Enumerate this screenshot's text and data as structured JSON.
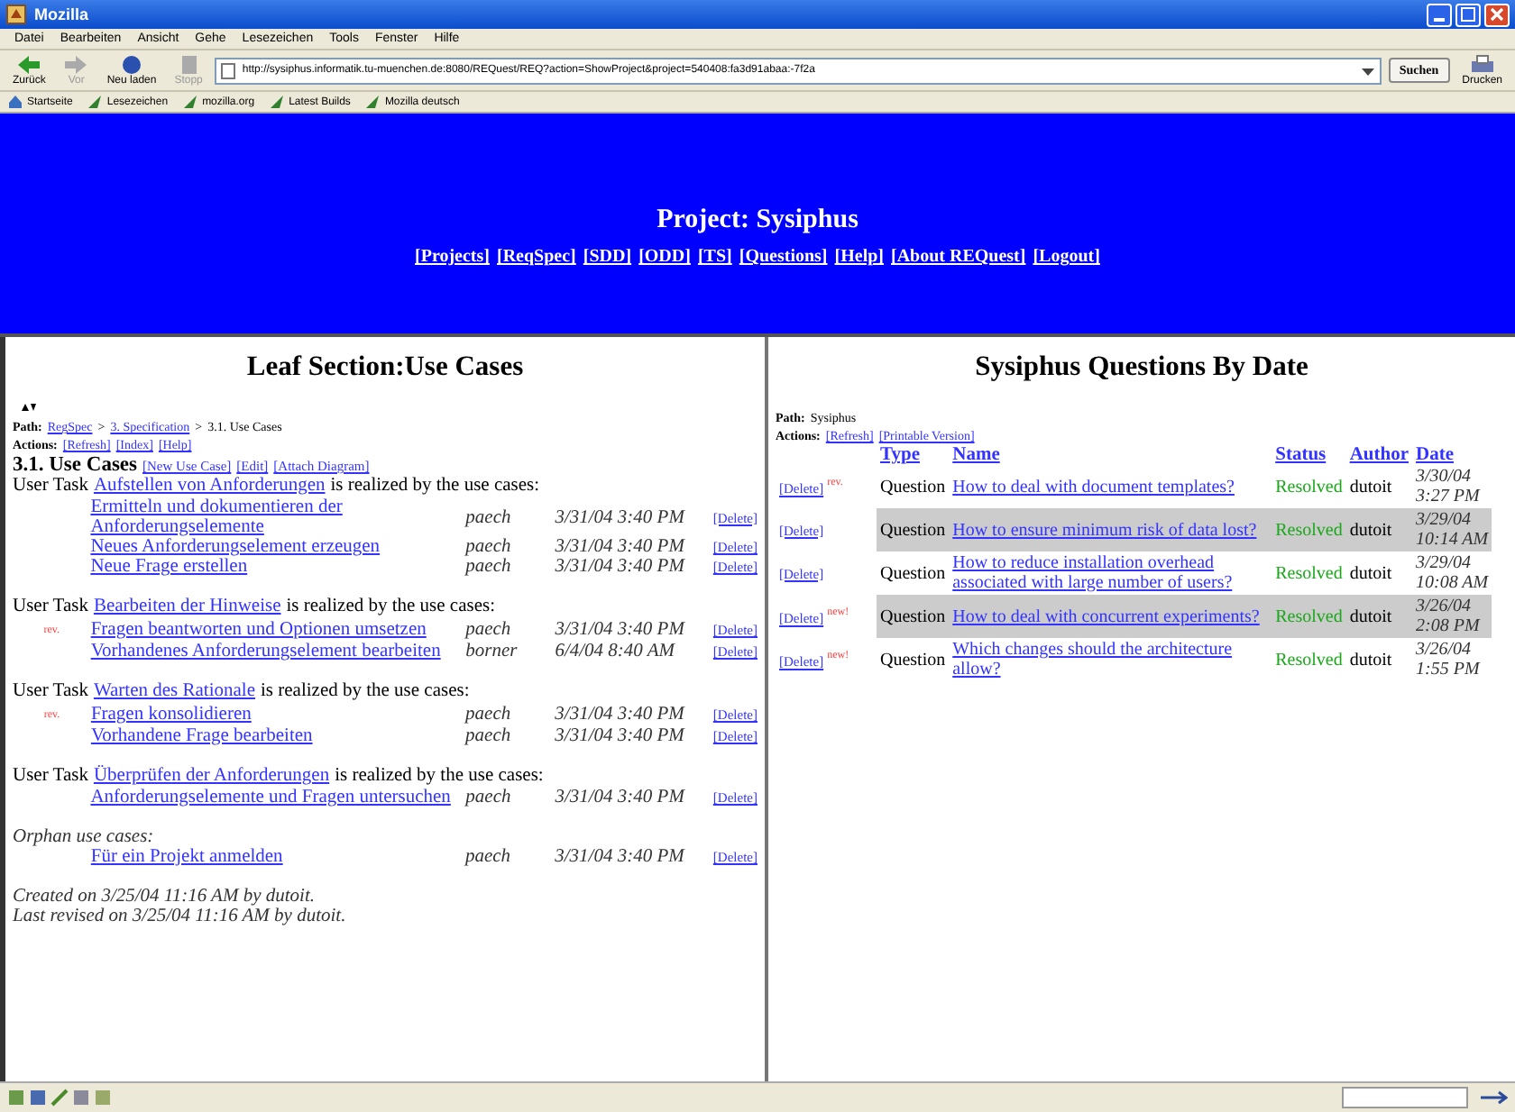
{
  "window": {
    "title": "Mozilla"
  },
  "menu": [
    "Datei",
    "Bearbeiten",
    "Ansicht",
    "Gehe",
    "Lesezeichen",
    "Tools",
    "Fenster",
    "Hilfe"
  ],
  "nav_buttons": [
    {
      "label": "Zurück",
      "disabled": false
    },
    {
      "label": "Vor",
      "disabled": true
    },
    {
      "label": "Neu laden",
      "disabled": false
    },
    {
      "label": "Stopp",
      "disabled": true
    }
  ],
  "url": "http://sysiphus.informatik.tu-muenchen.de:8080/REQuest/REQ?action=ShowProject&project=540408:fa3d91abaa:-7f2a",
  "search_button": "Suchen",
  "print_button": "Drucken",
  "bookmarks": [
    "Startseite",
    "Lesezeichen",
    "mozilla.org",
    "Latest Builds",
    "Mozilla deutsch"
  ],
  "header": {
    "title": "Project: Sysiphus",
    "links": [
      "[Projects]",
      "[ReqSpec]",
      "[SDD]",
      "[ODD]",
      "[TS]",
      "[Questions]",
      "[Help]",
      "[About REQuest]",
      "[Logout]"
    ]
  },
  "left": {
    "heading": "Leaf Section:Use Cases",
    "path_label": "Path:",
    "path": [
      {
        "text": "RegSpec",
        "link": true
      },
      {
        "text": ">",
        "link": false
      },
      {
        "text": "3. Specification",
        "link": true
      },
      {
        "text": ">",
        "link": false
      },
      {
        "text": "3.1. Use Cases",
        "link": false
      }
    ],
    "actions_label": "Actions:",
    "actions": [
      "[Refresh]",
      "[Index]",
      "[Help]"
    ],
    "section_title": "3.1. Use Cases",
    "section_actions": [
      "[New Use Case]",
      "[Edit]",
      "[Attach Diagram]"
    ],
    "tasks": [
      {
        "prefix": "User Task",
        "name": "Aufstellen von Anforderungen",
        "suffix": "is realized by the use cases:",
        "use_cases": [
          {
            "name": "Ermitteln und dokumentieren der Anforderungselemente",
            "author": "paech",
            "date": "3/31/04 3:40 PM",
            "delete": "[Delete]"
          },
          {
            "name": "Neues Anforderungselement erzeugen",
            "author": "paech",
            "date": "3/31/04 3:40 PM",
            "delete": "[Delete]"
          },
          {
            "name": "Neue Frage erstellen",
            "author": "paech",
            "date": "3/31/04 3:40 PM",
            "delete": "[Delete]"
          }
        ]
      },
      {
        "prefix": "User Task",
        "name": "Bearbeiten der Hinweise",
        "suffix": "is realized by the use cases:",
        "use_cases": [
          {
            "marker": "rev.",
            "name": "Fragen beantworten und Optionen umsetzen",
            "author": "paech",
            "date": "3/31/04 3:40 PM",
            "delete": "[Delete]"
          },
          {
            "name": "Vorhandenes Anforderungselement bearbeiten",
            "author": "borner",
            "date": "6/4/04 8:40 AM",
            "delete": "[Delete]"
          }
        ]
      },
      {
        "prefix": "User Task",
        "name": "Warten des Rationale",
        "suffix": "is realized by the use cases:",
        "use_cases": [
          {
            "marker": "rev.",
            "name": "Fragen konsolidieren",
            "author": "paech",
            "date": "3/31/04 3:40 PM",
            "delete": "[Delete]"
          },
          {
            "name": "Vorhandene Frage bearbeiten",
            "author": "paech",
            "date": "3/31/04 3:40 PM",
            "delete": "[Delete]"
          }
        ]
      },
      {
        "prefix": "User Task",
        "name": "Überprüfen der Anforderungen",
        "suffix": "is realized by the use cases:",
        "use_cases": [
          {
            "name": "Anforderungselemente und Fragen untersuchen",
            "author": "paech",
            "date": "3/31/04 3:40 PM",
            "delete": "[Delete]"
          }
        ]
      }
    ],
    "orphan": {
      "label": "Orphan use cases:",
      "use_cases": [
        {
          "name": "Für ein Projekt anmelden",
          "author": "paech",
          "date": "3/31/04 3:40 PM",
          "delete": "[Delete]"
        }
      ]
    },
    "created": "Created on 3/25/04 11:16 AM by dutoit.",
    "revised": "Last revised on 3/25/04 11:16 AM by dutoit."
  },
  "right": {
    "heading": "Sysiphus Questions By Date",
    "path_label": "Path:",
    "path": "Sysiphus",
    "actions_label": "Actions:",
    "actions": [
      "[Refresh]",
      "[Printable Version]"
    ],
    "columns": [
      "Type",
      "Name",
      "Status",
      "Author",
      "Date"
    ],
    "rows": [
      {
        "delete": "[Delete]",
        "marker": "rev.",
        "type": "Question",
        "name": "How to deal with document templates?",
        "status": "Resolved",
        "author": "dutoit",
        "date": "3/30/04",
        "time": "3:27 PM"
      },
      {
        "delete": "[Delete]",
        "type": "Question",
        "name": "How to ensure minimum risk of data lost?",
        "status": "Resolved",
        "author": "dutoit",
        "date": "3/29/04",
        "time": "10:14 AM"
      },
      {
        "delete": "[Delete]",
        "type": "Question",
        "name": "How to reduce installation overhead associated with large number of users?",
        "status": "Resolved",
        "author": "dutoit",
        "date": "3/29/04",
        "time": "10:08 AM"
      },
      {
        "delete": "[Delete]",
        "marker": "new!",
        "type": "Question",
        "name": "How to deal with concurrent experiments?",
        "status": "Resolved",
        "author": "dutoit",
        "date": "3/26/04",
        "time": "2:08 PM"
      },
      {
        "delete": "[Delete]",
        "marker": "new!",
        "type": "Question",
        "name": "Which changes should the architecture allow?",
        "status": "Resolved",
        "author": "dutoit",
        "date": "3/26/04",
        "time": "1:55 PM"
      }
    ]
  }
}
